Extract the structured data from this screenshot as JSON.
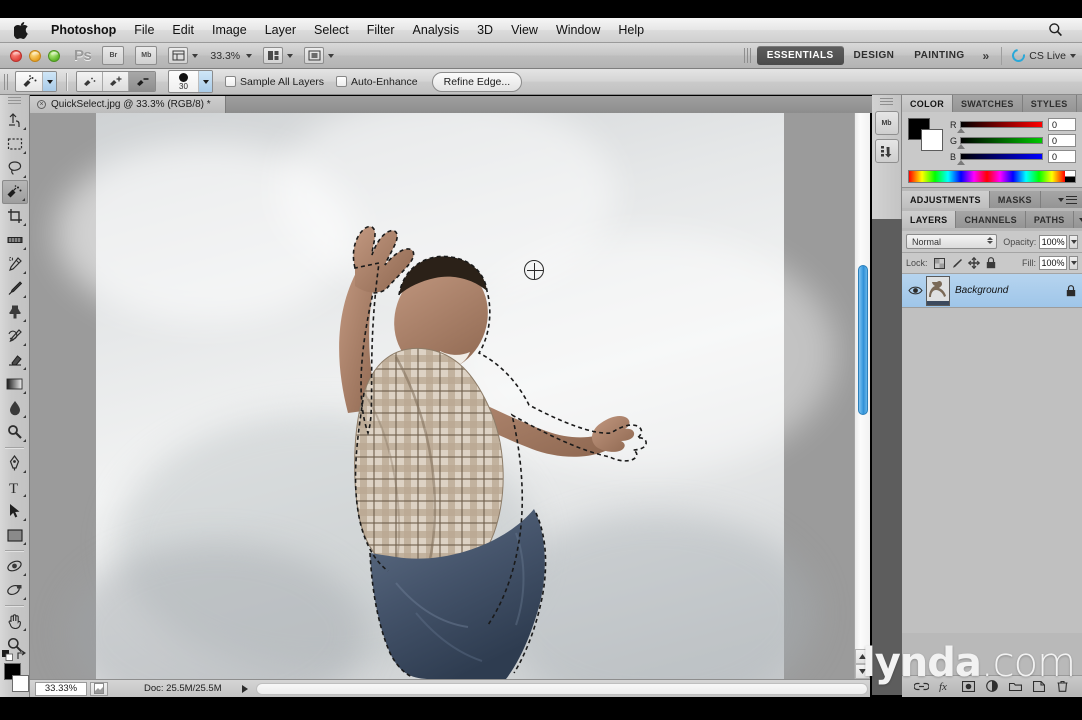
{
  "menubar": {
    "apple_icon": "apple-logo-icon",
    "items": [
      {
        "label": "Photoshop",
        "bold": true
      },
      {
        "label": "File",
        "bold": false
      },
      {
        "label": "Edit",
        "bold": false
      },
      {
        "label": "Image",
        "bold": false
      },
      {
        "label": "Layer",
        "bold": false
      },
      {
        "label": "Select",
        "bold": false
      },
      {
        "label": "Filter",
        "bold": false
      },
      {
        "label": "Analysis",
        "bold": false
      },
      {
        "label": "3D",
        "bold": false
      },
      {
        "label": "View",
        "bold": false
      },
      {
        "label": "Window",
        "bold": false
      },
      {
        "label": "Help",
        "bold": false
      }
    ],
    "search_icon": "spotlight-search-icon"
  },
  "appbar": {
    "logo": "Ps",
    "bridge_label": "Br",
    "minibridge_label": "Mb",
    "zoom_level": "33.3%",
    "workspaces": [
      {
        "label": "ESSENTIALS",
        "active": true
      },
      {
        "label": "DESIGN",
        "active": false
      },
      {
        "label": "PAINTING",
        "active": false
      }
    ],
    "more_label": "»",
    "cs_live_label": "CS Live"
  },
  "options_bar": {
    "tool_preset_icon": "quick-selection-tool-icon",
    "modes": [
      {
        "name": "new-selection",
        "active": false
      },
      {
        "name": "add-to-selection",
        "active": false
      },
      {
        "name": "subtract-from-selection",
        "active": true
      }
    ],
    "brush_size": "30",
    "sample_all_layers_label": "Sample All Layers",
    "sample_all_layers_checked": false,
    "auto_enhance_label": "Auto-Enhance",
    "auto_enhance_checked": false,
    "refine_edge_label": "Refine Edge..."
  },
  "document": {
    "tab_title": "QuickSelect.jpg @ 33.3% (RGB/8) *",
    "close_glyph": "×"
  },
  "toolbox": {
    "tools": [
      {
        "name": "move-tool",
        "selected": false,
        "has_flyout": true
      },
      {
        "name": "rectangular-marquee-tool",
        "selected": false,
        "has_flyout": true
      },
      {
        "name": "lasso-tool",
        "selected": false,
        "has_flyout": true
      },
      {
        "name": "quick-selection-tool",
        "selected": true,
        "has_flyout": true
      },
      {
        "name": "crop-tool",
        "selected": false,
        "has_flyout": true
      },
      {
        "name": "eyedropper-tool",
        "selected": false,
        "has_flyout": true
      },
      {
        "name": "spot-healing-brush-tool",
        "selected": false,
        "has_flyout": true
      },
      {
        "name": "brush-tool",
        "selected": false,
        "has_flyout": true
      },
      {
        "name": "clone-stamp-tool",
        "selected": false,
        "has_flyout": true
      },
      {
        "name": "history-brush-tool",
        "selected": false,
        "has_flyout": true
      },
      {
        "name": "eraser-tool",
        "selected": false,
        "has_flyout": true
      },
      {
        "name": "gradient-tool",
        "selected": false,
        "has_flyout": true
      },
      {
        "name": "blur-tool",
        "selected": false,
        "has_flyout": true
      },
      {
        "name": "dodge-tool",
        "selected": false,
        "has_flyout": true
      },
      {
        "name": "pen-tool",
        "selected": false,
        "has_flyout": true
      },
      {
        "name": "type-tool",
        "selected": false,
        "has_flyout": true
      },
      {
        "name": "path-selection-tool",
        "selected": false,
        "has_flyout": true
      },
      {
        "name": "rectangle-shape-tool",
        "selected": false,
        "has_flyout": true
      },
      {
        "name": "3d-object-rotate-tool",
        "selected": false,
        "has_flyout": true
      },
      {
        "name": "3d-camera-rotate-tool",
        "selected": false,
        "has_flyout": true
      },
      {
        "name": "hand-tool",
        "selected": false,
        "has_flyout": true
      },
      {
        "name": "zoom-tool",
        "selected": false,
        "has_flyout": false
      }
    ],
    "foreground_color": "#000000",
    "background_color": "#ffffff",
    "quick_mask_icon": "quick-mask-mode-icon"
  },
  "status_bar": {
    "zoom": "33.33%",
    "doc_info": "Doc: 25.5M/25.5M"
  },
  "icon_rail": {
    "buttons": [
      {
        "name": "mini-bridge-panel-icon",
        "label": "Mb"
      },
      {
        "name": "history-panel-icon",
        "label": ""
      }
    ]
  },
  "color_panel": {
    "tabs": [
      {
        "label": "COLOR",
        "active": true
      },
      {
        "label": "SWATCHES",
        "active": false
      },
      {
        "label": "STYLES",
        "active": false
      }
    ],
    "channels": [
      {
        "label": "R",
        "value": "0"
      },
      {
        "label": "G",
        "value": "0"
      },
      {
        "label": "B",
        "value": "0"
      }
    ]
  },
  "adjustments_panel": {
    "tabs": [
      {
        "label": "ADJUSTMENTS",
        "active": true
      },
      {
        "label": "MASKS",
        "active": false
      }
    ]
  },
  "layers_panel": {
    "tabs": [
      {
        "label": "LAYERS",
        "active": true
      },
      {
        "label": "CHANNELS",
        "active": false
      },
      {
        "label": "PATHS",
        "active": false
      }
    ],
    "blend_mode": "Normal",
    "opacity_label": "Opacity:",
    "opacity_value": "100%",
    "lock_label": "Lock:",
    "fill_label": "Fill:",
    "fill_value": "100%",
    "lock_icons": [
      "lock-transparent-pixels-icon",
      "lock-image-pixels-icon",
      "lock-position-icon",
      "lock-all-icon"
    ],
    "layers": [
      {
        "name": "Background",
        "visible": true,
        "locked": true,
        "selected": true
      }
    ],
    "footer_icons": [
      "link-layers-icon",
      "layer-style-fx-icon",
      "add-layer-mask-icon",
      "new-adjustment-layer-icon",
      "new-group-icon",
      "new-layer-icon",
      "delete-layer-icon"
    ]
  },
  "watermark": {
    "bold_text": "lynda",
    "light_text": ".com"
  },
  "canvas": {
    "brush_cursor": "quick-selection-brush-cursor",
    "selection_active": true,
    "subject": "dancing-man-photo"
  }
}
